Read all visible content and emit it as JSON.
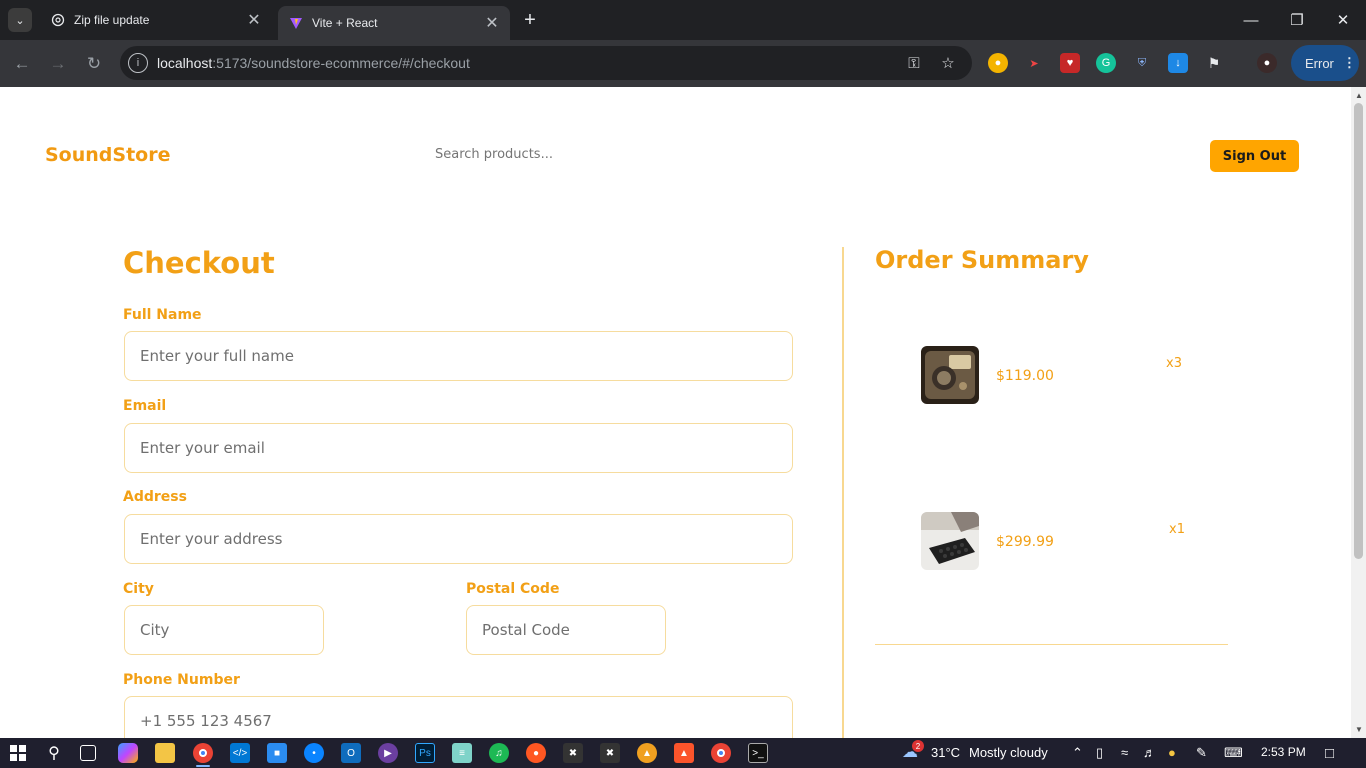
{
  "browser": {
    "tabs": [
      {
        "title": "Zip file update",
        "favicon": "openai-icon"
      },
      {
        "title": "Vite + React",
        "favicon": "vite-icon"
      }
    ],
    "url_host": "localhost",
    "url_path": ":5173/soundstore-ecommerce/#/checkout",
    "error_label": "Error"
  },
  "header": {
    "brand": "SoundStore",
    "search_placeholder": "Search products...",
    "signout_label": "Sign Out"
  },
  "checkout": {
    "title": "Checkout",
    "fields": {
      "full_name": {
        "label": "Full Name",
        "placeholder": "Enter your full name",
        "value": ""
      },
      "email": {
        "label": "Email",
        "placeholder": "Enter your email",
        "value": ""
      },
      "address": {
        "label": "Address",
        "placeholder": "Enter your address",
        "value": ""
      },
      "city": {
        "label": "City",
        "placeholder": "City",
        "value": ""
      },
      "postal_code": {
        "label": "Postal Code",
        "placeholder": "Postal Code",
        "value": ""
      },
      "phone": {
        "label": "Phone Number",
        "placeholder": "+1 555 123 4567",
        "value": ""
      }
    }
  },
  "summary": {
    "title": "Order Summary",
    "items": [
      {
        "price": "$119.00",
        "qty": "x3",
        "image": "vintage-meter-device"
      },
      {
        "price": "$299.99",
        "qty": "x1",
        "image": "black-mixer-pad"
      }
    ]
  },
  "taskbar": {
    "weather_temp": "31°C",
    "weather_desc": "Mostly cloudy",
    "weather_badge": "2",
    "time": "2:53 PM"
  },
  "colors": {
    "accent": "#f2a016",
    "button": "#ffa500",
    "field_border": "#f6dc9e"
  }
}
